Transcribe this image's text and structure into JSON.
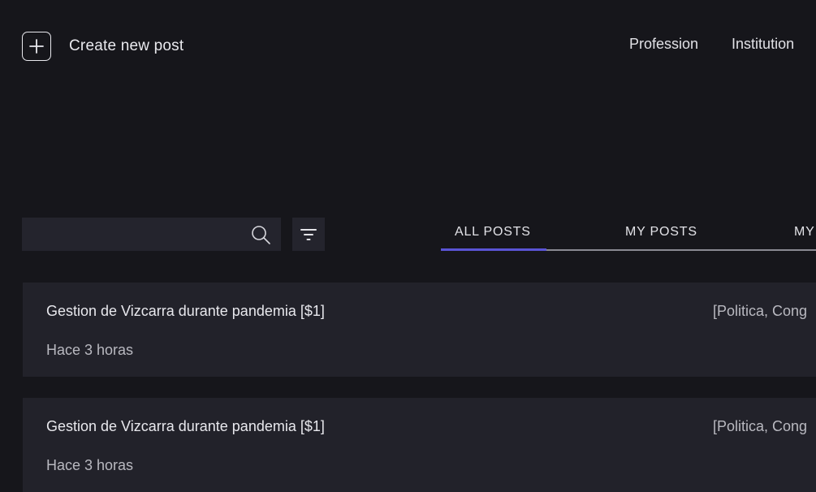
{
  "header": {
    "create_label": "Create new post",
    "nav": [
      "Profession",
      "Institution"
    ]
  },
  "search": {
    "value": "",
    "placeholder": ""
  },
  "tabs": [
    {
      "label": "ALL POSTS",
      "active": true
    },
    {
      "label": "MY POSTS",
      "active": false
    },
    {
      "label": "MY",
      "active": false
    }
  ],
  "posts": [
    {
      "title": "Gestion de Vizcarra durante pandemia [$1]",
      "time": "Hace 3 horas",
      "tags": "[Politica, Cong"
    },
    {
      "title": "Gestion de Vizcarra durante pandemia [$1]",
      "time": "Hace 3 horas",
      "tags": "[Politica, Cong"
    }
  ],
  "colors": {
    "background": "#16161b",
    "card": "#22222a",
    "accent": "#5a54d6"
  },
  "icons": {
    "create": "plus-icon",
    "search": "search-icon",
    "filter": "filter-icon"
  }
}
